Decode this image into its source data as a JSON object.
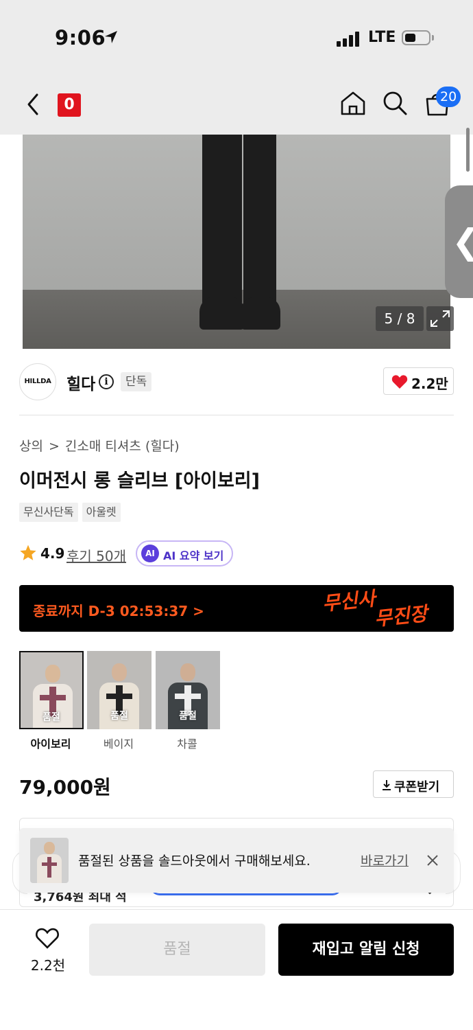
{
  "status_bar": {
    "time": "9:06",
    "network": "LTE"
  },
  "nav": {
    "logo_text": "0",
    "cart_count": "20"
  },
  "hero": {
    "image_counter": "5 / 8"
  },
  "brand": {
    "logo_text": "HILLDA",
    "name": "힐다",
    "info_glyph": "i",
    "exclusive_tag": "단독",
    "like_count": "2.2만"
  },
  "breadcrumb": {
    "category": "상의",
    "separator": ">",
    "subcategory": "긴소매 티셔츠 (힐다)"
  },
  "product": {
    "title": "이머전시 롱 슬리브 [아이보리]",
    "tags": [
      "무신사단독",
      "아울렛"
    ],
    "rating": "4.9",
    "review_link": "후기 50개",
    "ai_badge": "AI",
    "ai_summary_label": "AI 요약 보기",
    "price": "79,000원"
  },
  "promo": {
    "countdown": "종료까지 D-3 02:53:37 >",
    "brand_line1": "무신사",
    "brand_line2": "무진장"
  },
  "options": [
    {
      "label": "아이보리",
      "status": "품절",
      "selected": true
    },
    {
      "label": "베이지",
      "status": "품절",
      "selected": false
    },
    {
      "label": "차콜",
      "status": "품절",
      "selected": false
    }
  ],
  "coupon": {
    "label": "쿠폰받기"
  },
  "benefit": {
    "partial_text": "3,764원 최대 적"
  },
  "toast": {
    "message": "품절된 상품을 솔드아웃에서 구매해보세요.",
    "link_label": "바로가기"
  },
  "bottom_bar": {
    "wish_count": "2.2천",
    "soldout_label": "품절",
    "restock_label": "재입고 알림 신청"
  },
  "colors": {
    "brand_red": "#e0141e",
    "accent_orange": "#ff5a1f",
    "badge_blue": "#1a6ef5",
    "ai_purple": "#5b3fdc",
    "heart_red": "#e8192c",
    "star_orange": "#f5a623"
  }
}
